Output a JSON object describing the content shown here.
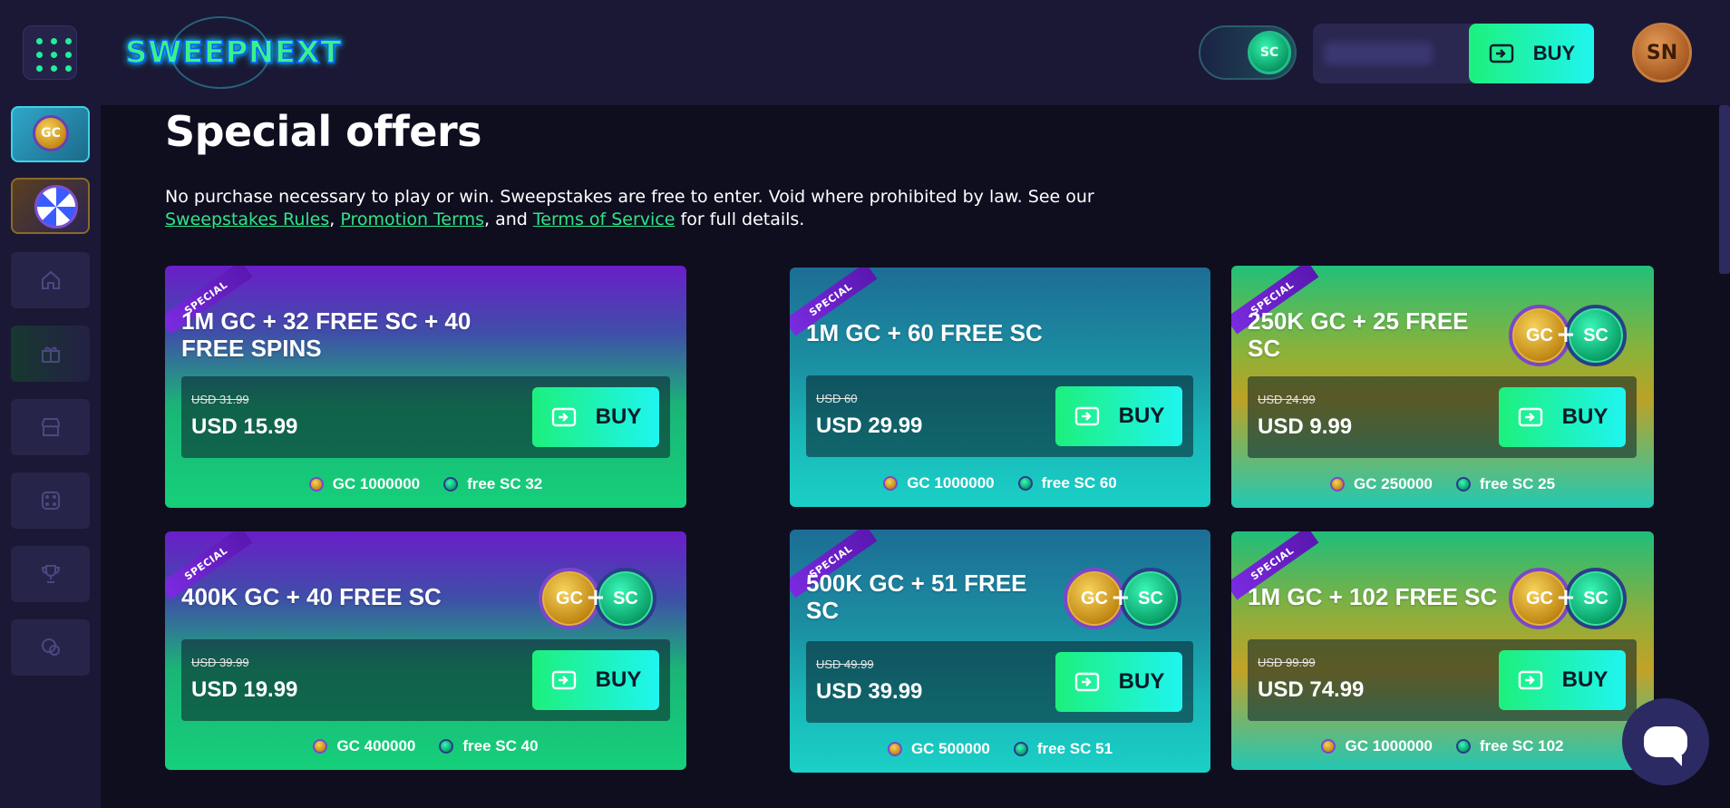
{
  "header": {
    "logo_text": "SWEEPNEXT",
    "toggle_label": "SC",
    "buy_label": "BUY",
    "avatar_initials": "SN"
  },
  "sidebar": {
    "promo_gc_label": "GC",
    "items": [
      {
        "name": "home",
        "icon": "home-icon"
      },
      {
        "name": "rewards",
        "icon": "gift-icon"
      },
      {
        "name": "store",
        "icon": "store-icon"
      },
      {
        "name": "games",
        "icon": "dice-icon"
      },
      {
        "name": "tournaments",
        "icon": "trophy-icon"
      },
      {
        "name": "support",
        "icon": "chat-icon"
      }
    ]
  },
  "main": {
    "title": "Special offers",
    "disclaimer_text": "No purchase necessary to play or win. Sweepstakes are free to enter. Void where prohibited by law. See our",
    "link_rules": "Sweepstakes Rules",
    "link_promo": "Promotion Terms",
    "link_tos": "Terms of Service",
    "sep_comma": ",",
    "sep_and": ", and",
    "disclaimer_tail": "for full details."
  },
  "offer_ribbon": "SPECIAL",
  "coin_labels": {
    "gc": "GC",
    "sc": "SC",
    "plus": "+"
  },
  "offers": [
    {
      "title_line1": "1M GC + 32 FREE SC + 40",
      "title_line2": "FREE SPINS",
      "old_price": "USD 31.99",
      "price": "USD 15.99",
      "buy": "BUY",
      "gc": "GC 1000000",
      "sc": "free SC 32"
    },
    {
      "title_line1": "1M GC + 60 FREE SC",
      "title_line2": "",
      "old_price": "USD 60",
      "price": "USD 29.99",
      "buy": "BUY",
      "gc": "GC 1000000",
      "sc": "free SC 60"
    },
    {
      "title_line1": "250K GC + 25 FREE",
      "title_line2": "SC",
      "old_price": "USD 24.99",
      "price": "USD 9.99",
      "buy": "BUY",
      "gc": "GC 250000",
      "sc": "free SC 25"
    },
    {
      "title_line1": "400K GC + 40 FREE SC",
      "title_line2": "",
      "old_price": "USD 39.99",
      "price": "USD 19.99",
      "buy": "BUY",
      "gc": "GC 400000",
      "sc": "free SC 40"
    },
    {
      "title_line1": "500K GC + 51 FREE",
      "title_line2": "SC",
      "old_price": "USD 49.99",
      "price": "USD 39.99",
      "buy": "BUY",
      "gc": "GC 500000",
      "sc": "free SC 51"
    },
    {
      "title_line1": "1M GC + 102 FREE SC",
      "title_line2": "",
      "old_price": "USD 99.99",
      "price": "USD 74.99",
      "buy": "BUY",
      "gc": "GC 1000000",
      "sc": "free SC 102"
    }
  ],
  "colors": {
    "accent_green": "#1df07c",
    "accent_cyan": "#1ff5f0",
    "link_green": "#2ee58a",
    "bg": "#0f0e1f",
    "panel": "#1a1835"
  }
}
